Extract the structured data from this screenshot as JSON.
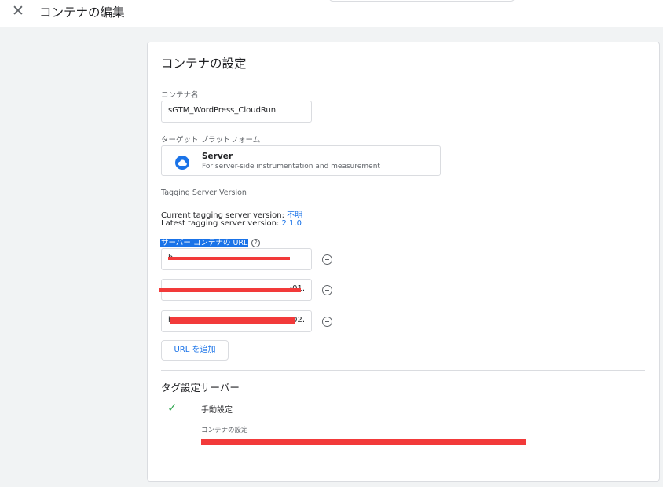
{
  "header": {
    "close_icon": "close-icon",
    "title": "コンテナの編集"
  },
  "card": {
    "title": "コンテナの設定",
    "container_name": {
      "label": "コンテナ名",
      "value": "sGTM_WordPress_CloudRun"
    },
    "target_platform": {
      "label": "ターゲット プラットフォーム",
      "icon": "cloud-icon",
      "name": "Server",
      "description": "For server-side instrumentation and measurement"
    },
    "server_version": {
      "label": "Tagging Server Version",
      "current_label": "Current tagging server version:",
      "current_value": "不明",
      "latest_label": "Latest tagging server version:",
      "latest_value": "2.1.0"
    },
    "server_urls": {
      "label": "サーバー コンテナの URL",
      "urls": [
        {
          "prefix": "h",
          "suffix": ""
        },
        {
          "prefix": "",
          "suffix": "-01."
        },
        {
          "prefix": "h",
          "suffix": "-02."
        }
      ],
      "add_button": "URL を追加"
    },
    "tag_server": {
      "title": "タグ設定サーバー",
      "option": "手動設定",
      "config_label": "コンテナの設定"
    }
  },
  "colors": {
    "accent": "#1a73e8",
    "check": "#34a853",
    "redaction": "#f23a3a"
  }
}
